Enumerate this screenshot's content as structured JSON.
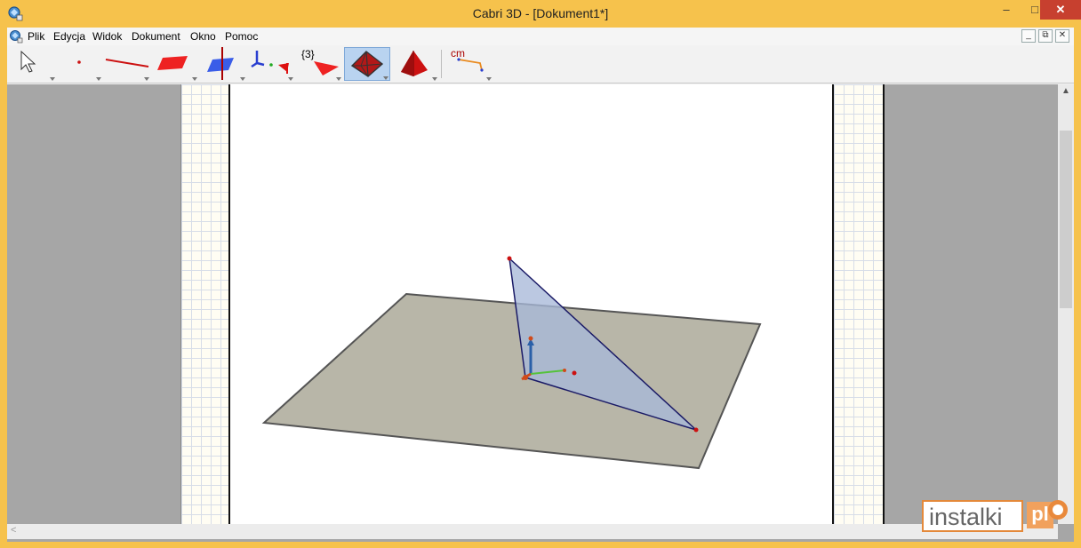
{
  "window": {
    "title": "Cabri 3D - [Dokument1*]",
    "controls": {
      "minimize": "–",
      "maximize": "□",
      "close": "✕"
    }
  },
  "menubar": {
    "items": [
      "Plik",
      "Edycja",
      "Widok",
      "Dokument",
      "Okno",
      "Pomoc"
    ],
    "mdi_controls": {
      "minimize": "_",
      "restore": "⧉",
      "close": "✕"
    }
  },
  "toolbar": {
    "tools": [
      {
        "name": "pointer-tool",
        "icon": "pointer-arrow-icon"
      },
      {
        "name": "point-tool",
        "icon": "point-icon"
      },
      {
        "name": "line-tool",
        "icon": "line-icon"
      },
      {
        "name": "plane-tool",
        "icon": "plane-icon"
      },
      {
        "name": "perpendicular-tool",
        "icon": "perpendicular-icon"
      },
      {
        "name": "transform-tool",
        "icon": "transform-icon"
      },
      {
        "name": "polygon-tool",
        "icon": "triangle-icon",
        "label": "{3}"
      },
      {
        "name": "polyhedron-tool",
        "icon": "polyhedron-icon",
        "active": true
      },
      {
        "name": "pyramid-tool",
        "icon": "pyramid-icon"
      },
      {
        "name": "measure-tool",
        "icon": "measure-icon",
        "label": "cm"
      }
    ]
  },
  "colors": {
    "title_bar": "#f6c24c",
    "close_button": "#c7402f",
    "active_tool": "#b9d3f0",
    "plane_fill": "#b8b6a8",
    "triangle_fill": "#a8b8d8",
    "edge": "#1a1a66",
    "point": "#cc1111",
    "workspace_bg": "#a6a6a6"
  },
  "watermark": {
    "text": "instalki",
    "suffix": "pl"
  }
}
